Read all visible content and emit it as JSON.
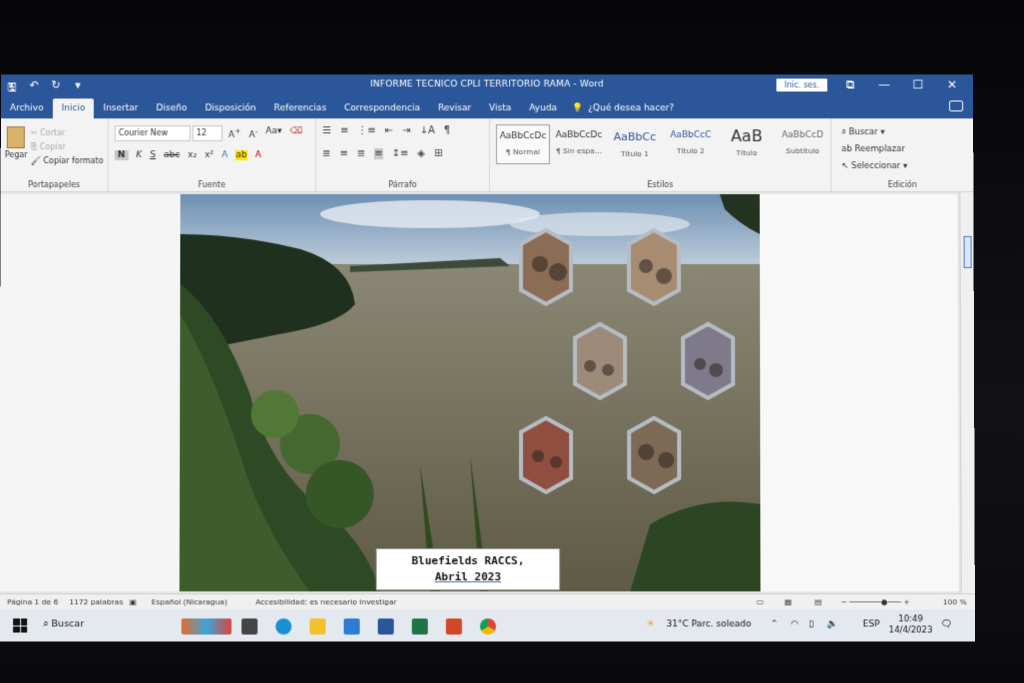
{
  "window": {
    "title": "INFORME TECNICO CPLI TERRITORIO RAMA  -  Word",
    "signin_label": "Inic. ses.",
    "controls": [
      "⧉",
      "—",
      "☐",
      "✕"
    ]
  },
  "tabs": [
    "Archivo",
    "Inicio",
    "Insertar",
    "Diseño",
    "Disposición",
    "Referencias",
    "Correspondencia",
    "Revisar",
    "Vista",
    "Ayuda"
  ],
  "tell_me": "¿Qué desea hacer?",
  "ribbon": {
    "clipboard": {
      "label": "Portapapeles",
      "paste": "Pegar",
      "cut": "Cortar",
      "copy": "Copiar",
      "format_painter": "Copiar formato"
    },
    "font": {
      "label": "Fuente",
      "family": "Courier New",
      "size": "12"
    },
    "paragraph": {
      "label": "Párrafo"
    },
    "styles": {
      "label": "Estilos",
      "items": [
        {
          "preview": "AaBbCcDc",
          "name": "¶ Normal"
        },
        {
          "preview": "AaBbCcDc",
          "name": "¶ Sin espa..."
        },
        {
          "preview": "AaBbCc",
          "name": "Título 1"
        },
        {
          "preview": "AaBbCcC",
          "name": "Título 2"
        },
        {
          "preview": "AaB",
          "name": "Título"
        },
        {
          "preview": "AaBbCcD",
          "name": "Subtítulo"
        }
      ]
    },
    "editing": {
      "label": "Edición",
      "find": "Buscar",
      "replace": "Reemplazar",
      "select": "Seleccionar"
    }
  },
  "document": {
    "caption_line1": "Bluefields RACCS,",
    "caption_line2": "Abril 2023"
  },
  "status": {
    "page": "Página 1 de 6",
    "words": "1172 palabras",
    "language": "Español (Nicaragua)",
    "accessibility": "Accesibilidad: es necesario investigar",
    "zoom": "100 %"
  },
  "taskbar": {
    "search_label": "Buscar",
    "weather": "31°C  Parc. soleado",
    "lang": "ESP",
    "time": "10:49",
    "date": "14/4/2023"
  }
}
